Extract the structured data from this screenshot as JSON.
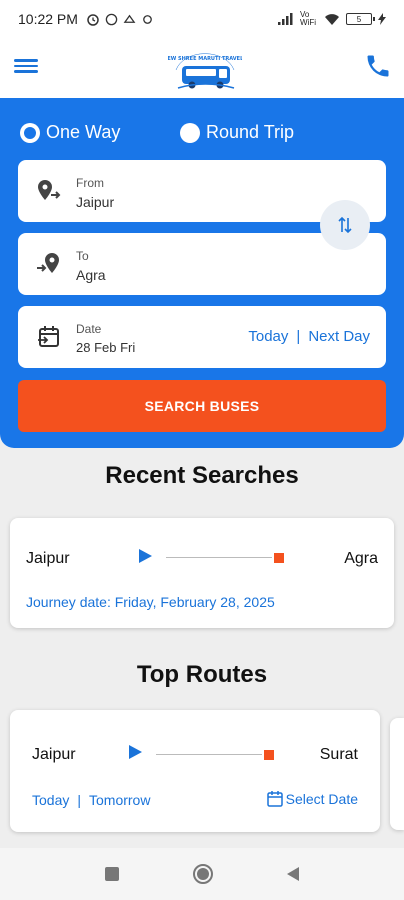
{
  "status_bar": {
    "time": "10:22 PM",
    "network": "Vo WiFi",
    "battery": "5"
  },
  "header": {
    "logo_text": "NEW SHREE MARUTI TRAVELS",
    "menu_icon": "hamburger-menu-icon",
    "phone_icon": "phone-icon"
  },
  "search": {
    "trip_types": [
      {
        "label": "One Way",
        "selected": true
      },
      {
        "label": "Round Trip",
        "selected": false
      }
    ],
    "from": {
      "label": "From",
      "value": "Jaipur"
    },
    "to": {
      "label": "To",
      "value": "Agra"
    },
    "date": {
      "label": "Date",
      "value": "28 Feb Fri"
    },
    "today_label": "Today",
    "separator": "|",
    "next_day_label": "Next Day",
    "search_button": "SEARCH BUSES"
  },
  "recent_searches": {
    "title": "Recent Searches",
    "items": [
      {
        "from": "Jaipur",
        "to": "Agra",
        "journey_date": "Journey date: Friday, February 28, 2025"
      }
    ]
  },
  "top_routes": {
    "title": "Top Routes",
    "items": [
      {
        "from": "Jaipur",
        "to": "Surat",
        "today": "Today",
        "separator": "|",
        "tomorrow": "Tomorrow",
        "select_date": "Select Date"
      }
    ]
  },
  "colors": {
    "primary": "#1976e8",
    "accent": "#f4511e",
    "link": "#1a73d9"
  }
}
